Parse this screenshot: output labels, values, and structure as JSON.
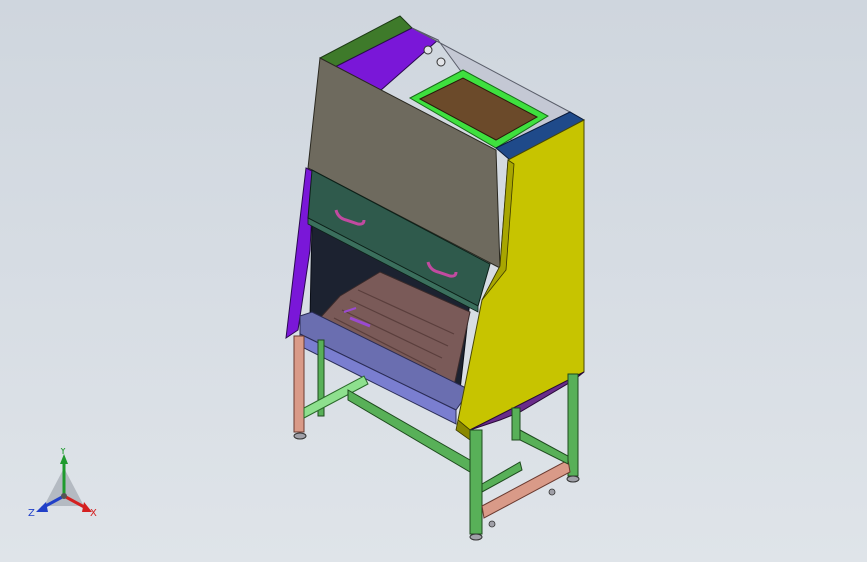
{
  "scene": {
    "background_top": "#cfd6de",
    "background_bottom": "#dfe4e9"
  },
  "triad": {
    "x_label": "X",
    "y_label": "Y",
    "z_label": "Z",
    "x_color": "#d42020",
    "y_color": "#1f9b2e",
    "z_color": "#2140c8"
  },
  "parts": {
    "top_panel": "#6e6a5e",
    "side_left": "#7a17d8",
    "side_right": "#c7c400",
    "sash": "#2f5a4c",
    "top_strip": "#3e7a2a",
    "top_blue": "#1f4a8a",
    "filter_frame": "#3ee03e",
    "filter_core": "#6b4a2a",
    "work_tray": "#7a5a58",
    "front_rail": "#6a6eb0",
    "legs": "#d99a88",
    "frame": "#58b058",
    "handles": "#c24aa0"
  }
}
